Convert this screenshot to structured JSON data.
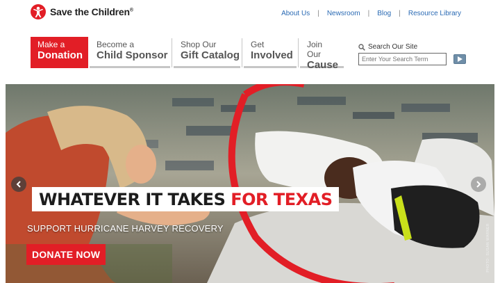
{
  "brand": {
    "name": "Save the Children",
    "reg": "®",
    "logo_icon": "save-the-children-figure-icon",
    "accent": "#e21e26"
  },
  "utility_nav": [
    "About Us",
    "Newsroom",
    "Blog",
    "Resource Library"
  ],
  "main_nav": [
    {
      "line1": "Make a",
      "line2": "Donation",
      "highlight": true
    },
    {
      "line1": "Become a",
      "line2": "Child Sponsor"
    },
    {
      "line1": "Shop Our",
      "line2": "Gift Catalog"
    },
    {
      "line1": "Get",
      "line2": "Involved"
    },
    {
      "line1": "Join Our",
      "line2": "Cause"
    }
  ],
  "search": {
    "label": "Search Our Site",
    "placeholder": "Enter Your Search Term",
    "icon": "search-icon",
    "button_icon": "play-arrow-icon"
  },
  "hero": {
    "headline_part1": "WHATEVER IT TAKES",
    "headline_part2": "FOR TEXAS",
    "subheadline": "SUPPORT HURRICANE HARVEY RECOVERY",
    "cta": "DONATE NOW",
    "photo_credit": "PHOTO: SUSAN WARNER"
  }
}
